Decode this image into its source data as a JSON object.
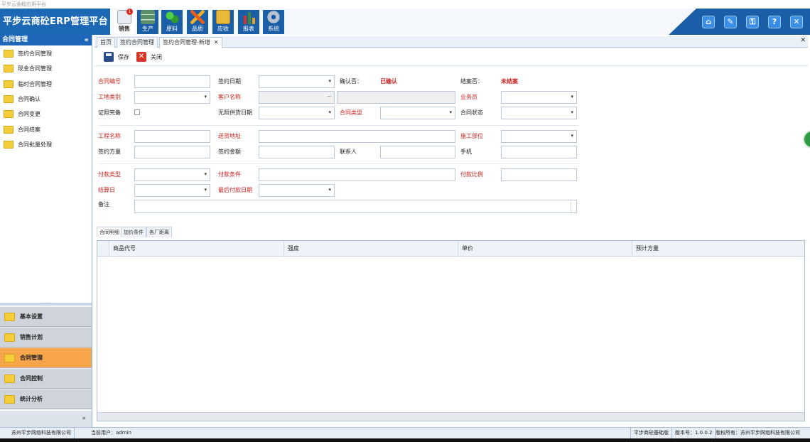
{
  "window_title": "平步云金程应用平台",
  "app_title": "平步云商砼ERP管理平台",
  "modules": [
    {
      "label": "销售",
      "badge": "1"
    },
    {
      "label": "生产"
    },
    {
      "label": "原料"
    },
    {
      "label": "品质"
    },
    {
      "label": "应收"
    },
    {
      "label": "报表"
    },
    {
      "label": "系统"
    }
  ],
  "header_buttons": [
    {
      "icon": "home-icon",
      "glyph": "⌂"
    },
    {
      "icon": "wrench-icon",
      "glyph": "✎"
    },
    {
      "icon": "key-icon",
      "glyph": "⚿"
    },
    {
      "icon": "help-icon",
      "glyph": "?"
    },
    {
      "icon": "close-icon",
      "glyph": "✕"
    }
  ],
  "sidebar": {
    "title": "合同管理",
    "collapse": "«",
    "items": [
      "签约合同管理",
      "现金合同管理",
      "临时合同管理",
      "合同确认",
      "合同变更",
      "合同结案",
      "合同批量处理"
    ],
    "sections": [
      "基本设置",
      "销售计划",
      "合同管理",
      "合同控制",
      "统计分析"
    ],
    "active_section": "合同管理",
    "more": "»"
  },
  "tabs": [
    "首页",
    "签约合同管理",
    "签约合同管理-新增"
  ],
  "tab_close": "✕",
  "tabs_close_all": "✕",
  "toolbar": {
    "save": "保存",
    "close": "关闭"
  },
  "form": {
    "contract_no": "合同编号",
    "sign_date": "签约日期",
    "confirmed_label": "确认否：",
    "confirmed_value": "已确认",
    "closed_label": "结案否：",
    "closed_value": "未结案",
    "site_type": "工地类别",
    "customer_name": "客户名称",
    "salesman": "业务员",
    "license_complete": "证照完备",
    "no_license_date": "无照供货日期",
    "contract_type": "合同类型",
    "contract_status": "合同状态",
    "project_name": "工程名称",
    "delivery_address": "送货地址",
    "construction_unit": "施工部位",
    "signed_volume": "签约方量",
    "signed_amount": "签约金额",
    "contact": "联系人",
    "mobile": "手机",
    "payment_type": "付款类型",
    "payment_terms": "付款条件",
    "payment_ratio": "付款比例",
    "settlement_day": "结算日",
    "last_payment_date": "最后付款日期",
    "remark": "备注"
  },
  "detail_tabs": [
    "合同明细",
    "加价条件",
    "各厂距离"
  ],
  "grid_columns": [
    "商品代号",
    "强度",
    "单价",
    "预计方量"
  ],
  "status_bar": {
    "company": "苏州平步网络科技有限公司",
    "user": "当前用户：admin",
    "edition": "平步商砼基础版",
    "version": "版本号：1.0.0.2",
    "copyright": "版权所有：苏州平步网络科技有限公司"
  },
  "colors": {
    "header_blue": "#1a5ea8",
    "required_red": "#c8201a",
    "active_section": "#f7a54b"
  }
}
